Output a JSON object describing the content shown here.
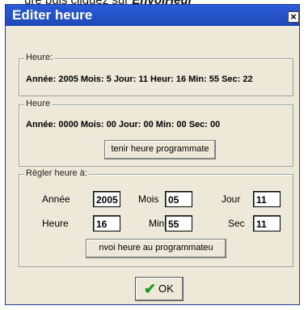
{
  "background_caption": {
    "prefix": "ure puis cliquez sur ",
    "bold": "EnvoiHeur"
  },
  "dialog": {
    "title": "Editer heure",
    "close": "×"
  },
  "group_current": {
    "legend": "Heure:",
    "value": "Année: 2005 Mois:  5 Jour: 11 Heur: 16 Min: 55 Sec: 22"
  },
  "group_programmer": {
    "legend": "Heure",
    "value": "Année: 0000 Mois: 00 Jour: 00 Min: 00 Sec: 00",
    "button": "tenir heure programmate"
  },
  "group_set": {
    "legend": "Règler heure à:",
    "annee": {
      "label": "Année",
      "value": "2005"
    },
    "mois": {
      "label": "Mois",
      "value": "05"
    },
    "jour": {
      "label": "Jour",
      "value": "11"
    },
    "heure": {
      "label": "Heure",
      "value": "16"
    },
    "min": {
      "label": "Min",
      "value": "55"
    },
    "sec": {
      "label": "Sec",
      "value": "11"
    },
    "button": "nvoi heure au programmateu"
  },
  "ok_button": {
    "label": "OK",
    "icon": "checkmark-icon"
  }
}
